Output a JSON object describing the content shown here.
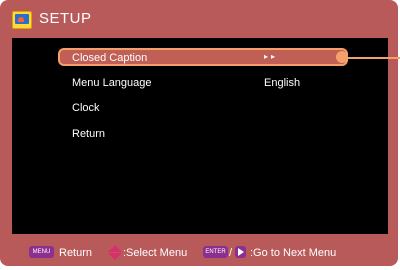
{
  "header": {
    "icon": "setup-icon",
    "title": "SETUP"
  },
  "menu": {
    "items": [
      {
        "label": "Closed Caption",
        "value": "▸▸",
        "selected": true
      },
      {
        "label": "Menu Language",
        "value": "English",
        "selected": false
      },
      {
        "label": "Clock",
        "value": "",
        "selected": false
      },
      {
        "label": "Return",
        "value": "",
        "selected": false
      }
    ]
  },
  "footer": {
    "menu_key": "MENU",
    "return_label": "Return",
    "select_label": ":Select Menu",
    "enter_key": "ENTER",
    "slash": "/",
    "next_label": ":Go to Next Menu"
  },
  "colors": {
    "frame": "#b95a5a",
    "panel": "#000000",
    "highlight": "#bf5f55",
    "highlight_border": "#f5a06b",
    "key_badge": "#8d2f8f"
  }
}
